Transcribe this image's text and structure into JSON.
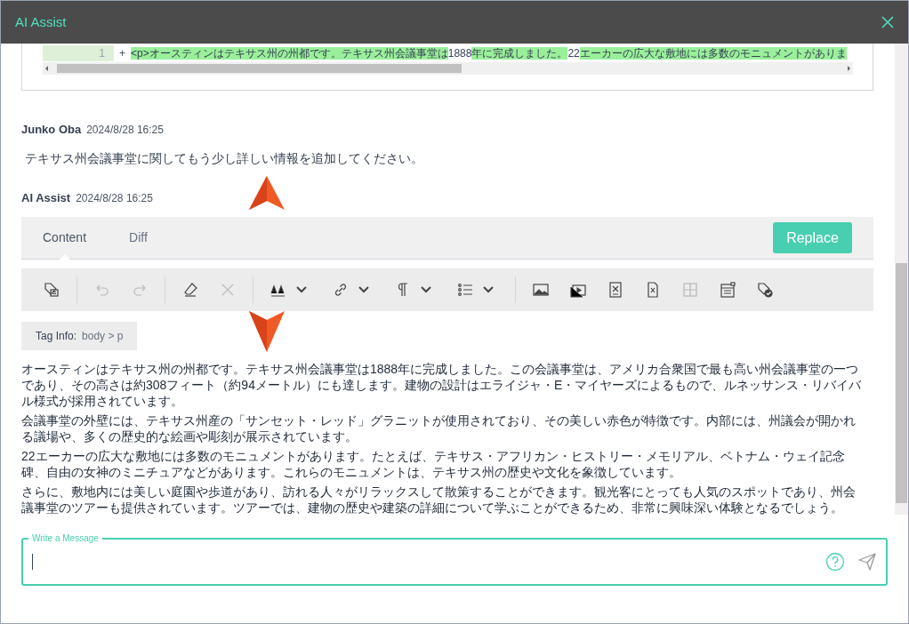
{
  "window": {
    "title": "AI Assist"
  },
  "diff": {
    "line_number": "1",
    "marker": "+",
    "segments": [
      {
        "text": "<p>オースティンはテキサス州の州都です。テキサス州会議事堂は",
        "changed": true
      },
      {
        "text": "1888",
        "changed": false
      },
      {
        "text": "年に完成しました。",
        "changed": true
      },
      {
        "text": "22",
        "changed": false
      },
      {
        "text": "エーカーの広大な敷地には多数のモニュメントがありま",
        "changed": true
      }
    ]
  },
  "messages": [
    {
      "author": "Junko Oba",
      "time": "2024/8/28 16:25",
      "text": "テキサス州会議事堂に関してもう少し詳しい情報を追加してください。"
    }
  ],
  "reply": {
    "author": "AI Assist",
    "time": "2024/8/28 16:25",
    "tabs": [
      {
        "label": "Content",
        "selected": true
      },
      {
        "label": "Diff",
        "selected": false
      }
    ],
    "replace_button": "Replace",
    "toolbar": [
      [
        {
          "kind": "tags",
          "disabled": false,
          "dropdown": false
        }
      ],
      [
        {
          "kind": "undo",
          "disabled": true,
          "dropdown": false
        },
        {
          "kind": "redo",
          "disabled": true,
          "dropdown": false
        }
      ],
      [
        {
          "kind": "eraser",
          "disabled": false,
          "dropdown": false
        },
        {
          "kind": "clear",
          "disabled": true,
          "dropdown": false
        }
      ],
      [
        {
          "kind": "font",
          "disabled": false,
          "dropdown": true
        },
        {
          "kind": "link",
          "disabled": false,
          "dropdown": true
        },
        {
          "kind": "paragraph",
          "disabled": false,
          "dropdown": true
        },
        {
          "kind": "list",
          "disabled": false,
          "dropdown": true
        }
      ],
      [
        {
          "kind": "image",
          "disabled": false,
          "dropdown": false
        },
        {
          "kind": "video",
          "disabled": false,
          "dropdown": false
        },
        {
          "kind": "document",
          "disabled": false,
          "dropdown": false
        },
        {
          "kind": "file",
          "disabled": false,
          "dropdown": false
        },
        {
          "kind": "table",
          "disabled": true,
          "dropdown": false
        },
        {
          "kind": "widget",
          "disabled": false,
          "dropdown": false
        },
        {
          "kind": "tag-check",
          "disabled": false,
          "dropdown": false
        }
      ]
    ],
    "tag_info": {
      "label": "Tag Info:",
      "path": [
        "body",
        "p"
      ],
      "separator": ">"
    },
    "paragraphs": [
      "オースティンはテキサス州の州都です。テキサス州会議事堂は1888年に完成しました。この会議事堂は、アメリカ合衆国で最も高い州会議事堂の一つであり、その高さは約308フィート（約94メートル）にも達します。建物の設計はエライジャ・E・マイヤーズによるもので、ルネッサンス・リバイバル様式が採用されています。",
      "会議事堂の外壁には、テキサス州産の「サンセット・レッド」グラニットが使用されており、その美しい赤色が特徴です。内部には、州議会が開かれる議場や、多くの歴史的な絵画や彫刻が展示されています。",
      "22エーカーの広大な敷地には多数のモニュメントがあります。たとえば、テキサス・アフリカン・ヒストリー・メモリアル、ベトナム・ウェイ記念碑、自由の女神のミニチュアなどがあります。これらのモニュメントは、テキサス州の歴史や文化を象徴しています。",
      "さらに、敷地内には美しい庭園や歩道があり、訪れる人々がリラックスして散策することができます。観光客にとっても人気のスポットであり、州会議事堂のツアーも提供されています。ツアーでは、建物の歴史や建築の詳細について学ぶことができるため、非常に興味深い体験となるでしょう。"
    ]
  },
  "composer": {
    "label": "Write a Message"
  }
}
